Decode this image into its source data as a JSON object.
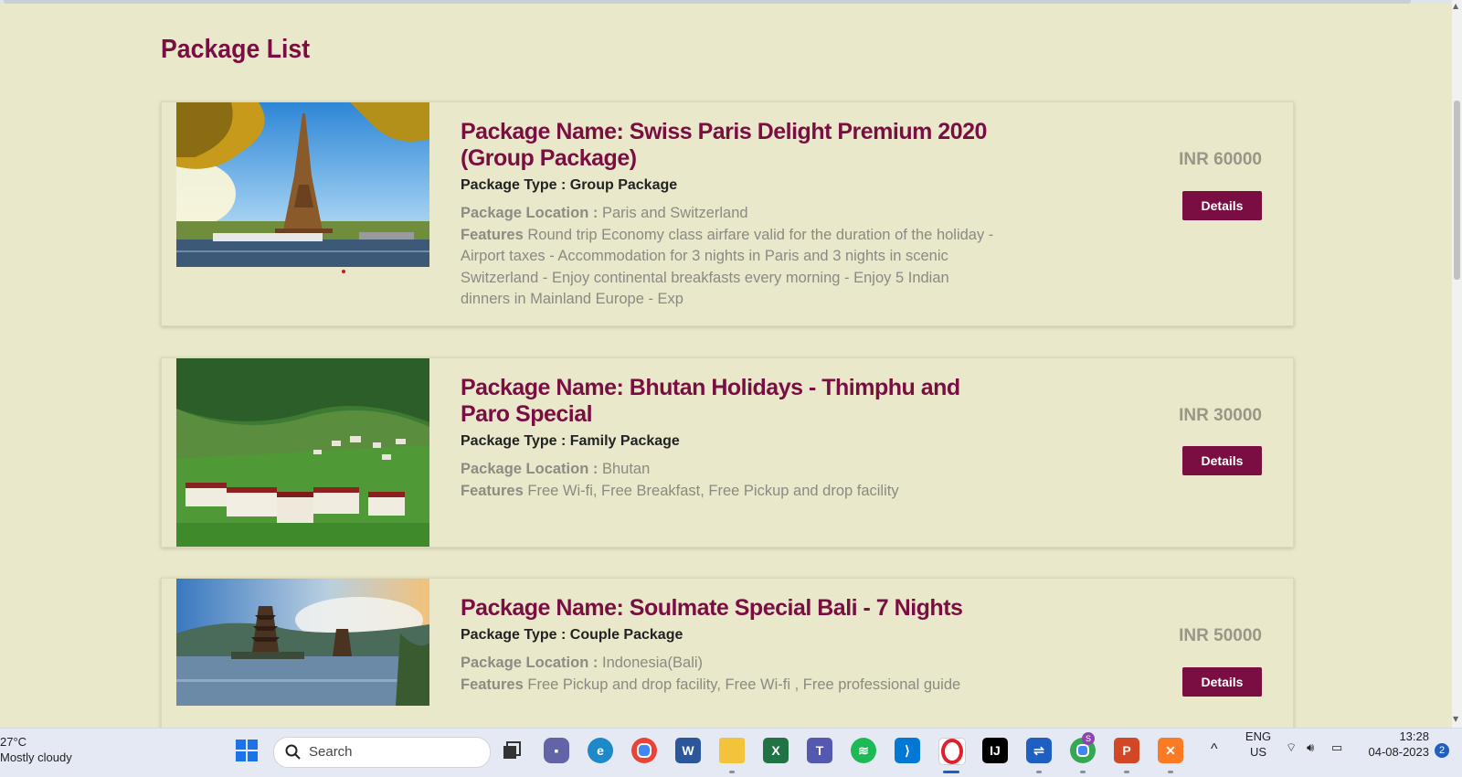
{
  "page": {
    "heading": "Package List"
  },
  "packages": [
    {
      "name": "Package Name: Swiss Paris Delight Premium 2020 (Group Package)",
      "type": "Package Type : Group Package",
      "location_label": "Package Location :",
      "location": "Paris and Switzerland",
      "features_label": "Features",
      "features": "Round trip Economy class airfare valid for the duration of the holiday - Airport taxes - Accommodation for 3 nights in Paris and 3 nights in scenic Switzerland - Enjoy continental breakfasts every morning - Enjoy 5 Indian dinners in Mainland Europe - Exp",
      "price": "INR 60000",
      "button": "Details",
      "image": "eiffel-tower-photo"
    },
    {
      "name": "Package Name: Bhutan Holidays - Thimphu and Paro Special",
      "type": "Package Type : Family Package",
      "location_label": "Package Location :",
      "location": "Bhutan",
      "features_label": "Features",
      "features": "Free Wi-fi, Free Breakfast, Free Pickup and drop facility",
      "price": "INR 30000",
      "button": "Details",
      "image": "bhutan-valley-photo"
    },
    {
      "name": "Package Name: Soulmate Special Bali - 7 Nights",
      "type": "Package Type : Couple Package",
      "location_label": "Package Location :",
      "location": "Indonesia(Bali)",
      "features_label": "Features",
      "features": "Free Pickup and drop facility, Free Wi-fi , Free professional guide",
      "price": "INR 50000",
      "button": "Details",
      "image": "bali-temple-photo"
    }
  ],
  "taskbar": {
    "weather_temp": "27°C",
    "weather_desc": "Mostly cloudy",
    "search_placeholder": "Search",
    "lang_top": "ENG",
    "lang_bottom": "US",
    "time": "13:28",
    "date": "04-08-2023",
    "notification_count": "2",
    "chrome_badge": "S",
    "apps": [
      "windows-start",
      "search",
      "task-view",
      "teams-chat",
      "edge",
      "chrome",
      "word",
      "file-explorer",
      "excel",
      "teams",
      "spotify",
      "vscode",
      "opera",
      "intellij",
      "remote-desktop",
      "chrome-profile",
      "powerpoint",
      "xampp"
    ]
  },
  "colors": {
    "page_bg": "#eae8ca",
    "accent": "#7a0e42",
    "price": "#999688"
  }
}
